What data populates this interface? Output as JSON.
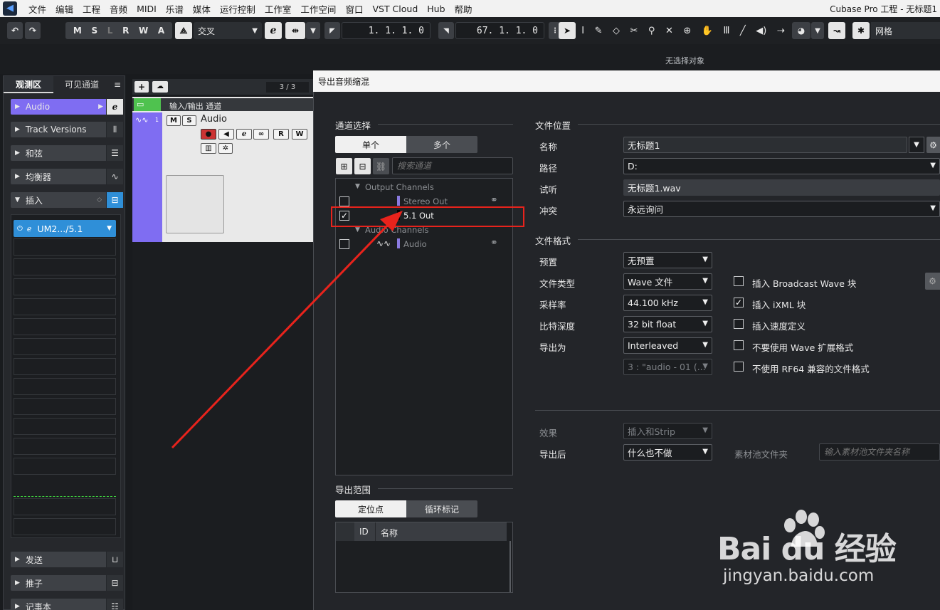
{
  "menubar": {
    "items": [
      "文件",
      "编辑",
      "工程",
      "音频",
      "MIDI",
      "乐谱",
      "媒体",
      "运行控制",
      "工作室",
      "工作空间",
      "窗口",
      "VST Cloud",
      "Hub",
      "帮助"
    ],
    "window_title": "Cubase Pro 工程 - 无标题1"
  },
  "toolbar": {
    "mode_letters": [
      "M",
      "S",
      "L",
      "R",
      "W",
      "A"
    ],
    "automation_mode": "交叉",
    "left_locator": "1. 1. 1.   0",
    "right_locator": "67. 1. 1.   0",
    "snap_type": "网格",
    "no_selection": "无选择对象"
  },
  "inspector": {
    "tabs": [
      "观测区",
      "可见通道"
    ],
    "track_name": "Audio",
    "sections": [
      "Track Versions",
      "和弦",
      "均衡器",
      "插入"
    ],
    "insert_plugin": "UM2.../5.1",
    "bottom_sections": [
      "发送",
      "推子",
      "记事本"
    ]
  },
  "tracklist": {
    "count": "3 / 3",
    "folder_label": "输入/输出 通道",
    "track_number": "1",
    "track_name": "Audio"
  },
  "dialog": {
    "title": "导出音频缩混",
    "channel_select": {
      "header": "通道选择",
      "tabs": [
        "单个",
        "多个"
      ],
      "search_placeholder": "搜索通道",
      "groups": [
        {
          "name": "Output Channels",
          "items": [
            {
              "name": "Stereo Out",
              "checked": false,
              "color": "#8a7ae0"
            },
            {
              "name": "5.1 Out",
              "checked": true,
              "color": "#000000"
            }
          ]
        },
        {
          "name": "Audio Channels",
          "items": [
            {
              "name": "Audio",
              "checked": false,
              "color": "#8a7ae0"
            }
          ]
        }
      ]
    },
    "export_range": {
      "header": "导出范围",
      "tabs": [
        "定位点",
        "循环标记"
      ],
      "columns": [
        "ID",
        "名称"
      ]
    },
    "file_location": {
      "header": "文件位置",
      "name_label": "名称",
      "name_value": "无标题1",
      "path_label": "路径",
      "path_value": "D:",
      "preview_label": "试听",
      "preview_value": "无标题1.wav",
      "conflict_label": "冲突",
      "conflict_value": "永远询问"
    },
    "file_format": {
      "header": "文件格式",
      "preset_label": "预置",
      "preset_value": "无预置",
      "type_label": "文件类型",
      "type_value": "Wave 文件",
      "rate_label": "采样率",
      "rate_value": "44.100 kHz",
      "depth_label": "比特深度",
      "depth_value": "32 bit float",
      "export_as_label": "导出为",
      "export_as_value": "Interleaved",
      "channel_naming_value": "3 : \"audio - 01 (...",
      "options": [
        {
          "label": "插入 Broadcast Wave 块",
          "checked": false
        },
        {
          "label": "插入 iXML 块",
          "checked": true
        },
        {
          "label": "插入速度定义",
          "checked": false
        },
        {
          "label": "不要使用 Wave 扩展格式",
          "checked": false
        },
        {
          "label": "不使用 RF64 兼容的文件格式",
          "checked": false
        }
      ]
    },
    "post": {
      "effects_label": "效果",
      "effects_value": "插入和Strip",
      "after_export_label": "导出后",
      "after_export_value": "什么也不做",
      "pool_folder_label": "素材池文件夹",
      "pool_folder_placeholder": "输入素材池文件夹名称"
    }
  },
  "watermark": {
    "logo": "Bai du 经验",
    "url": "jingyan.baidu.com"
  },
  "colors": {
    "accent_purple": "#7f6df2",
    "insert_blue": "#2f8fd8",
    "annotation_red": "#e8231c",
    "folder_green": "#4fc24f"
  }
}
